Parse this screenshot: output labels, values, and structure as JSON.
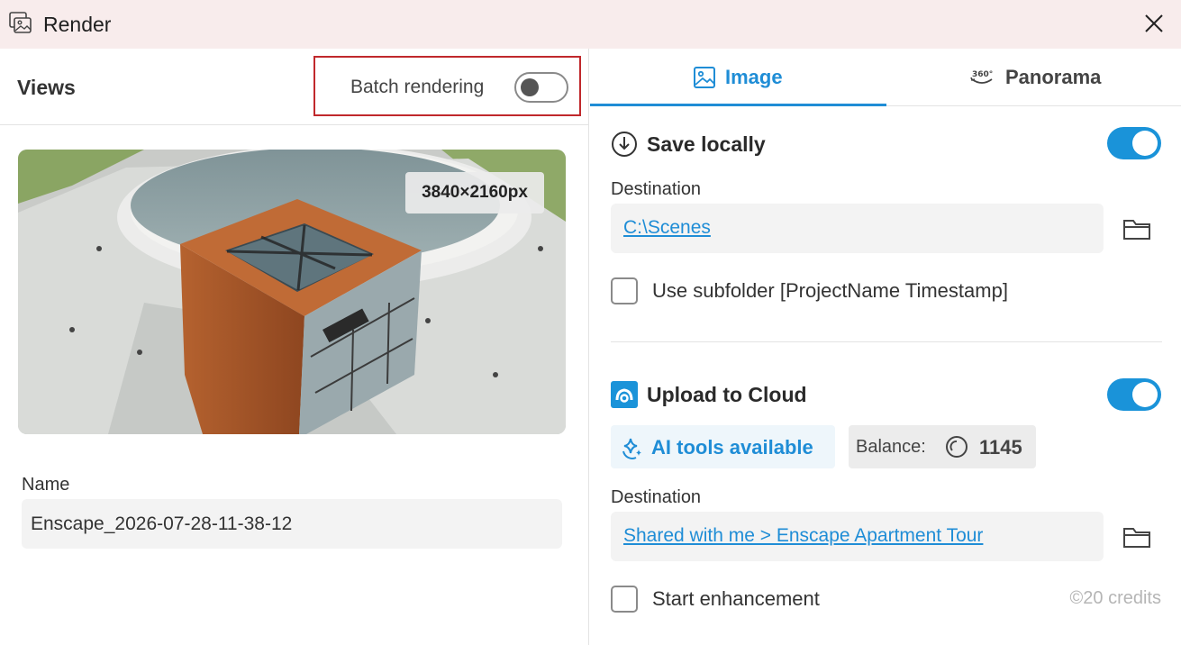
{
  "window": {
    "title": "Render",
    "app_icon": "images-icon",
    "close_icon": "close-icon"
  },
  "views": {
    "title": "Views",
    "batch_label": "Batch rendering",
    "batch_enabled": false,
    "preview_resolution": "3840×2160px",
    "name_label": "Name",
    "name_value": "Enscape_2026-07-28-11-38-12"
  },
  "tabs": [
    {
      "label": "Image",
      "icon": "image-icon",
      "active": true
    },
    {
      "label": "Panorama",
      "icon": "panorama-360-icon",
      "active": false
    }
  ],
  "save_locally": {
    "title": "Save locally",
    "icon": "download-circle-icon",
    "enabled": true,
    "destination_label": "Destination",
    "destination_value": "C:\\Scenes",
    "subfolder_label": "Use subfolder [ProjectName Timestamp]",
    "subfolder_checked": false
  },
  "upload_cloud": {
    "title": "Upload to Cloud",
    "icon": "cloud-logo-icon",
    "enabled": true,
    "ai_label": "AI tools available",
    "balance_label": "Balance:",
    "balance_value": "1145",
    "destination_label": "Destination",
    "destination_value": "Shared with me > Enscape Apartment Tour",
    "enhancement_label": "Start enhancement",
    "enhancement_checked": false,
    "credits": "©20 credits"
  },
  "colors": {
    "accent": "#1f8dd6",
    "toggle_on": "#1a93d9",
    "titlebar_bg": "#f8ecec",
    "highlight_border": "#c0282c"
  }
}
